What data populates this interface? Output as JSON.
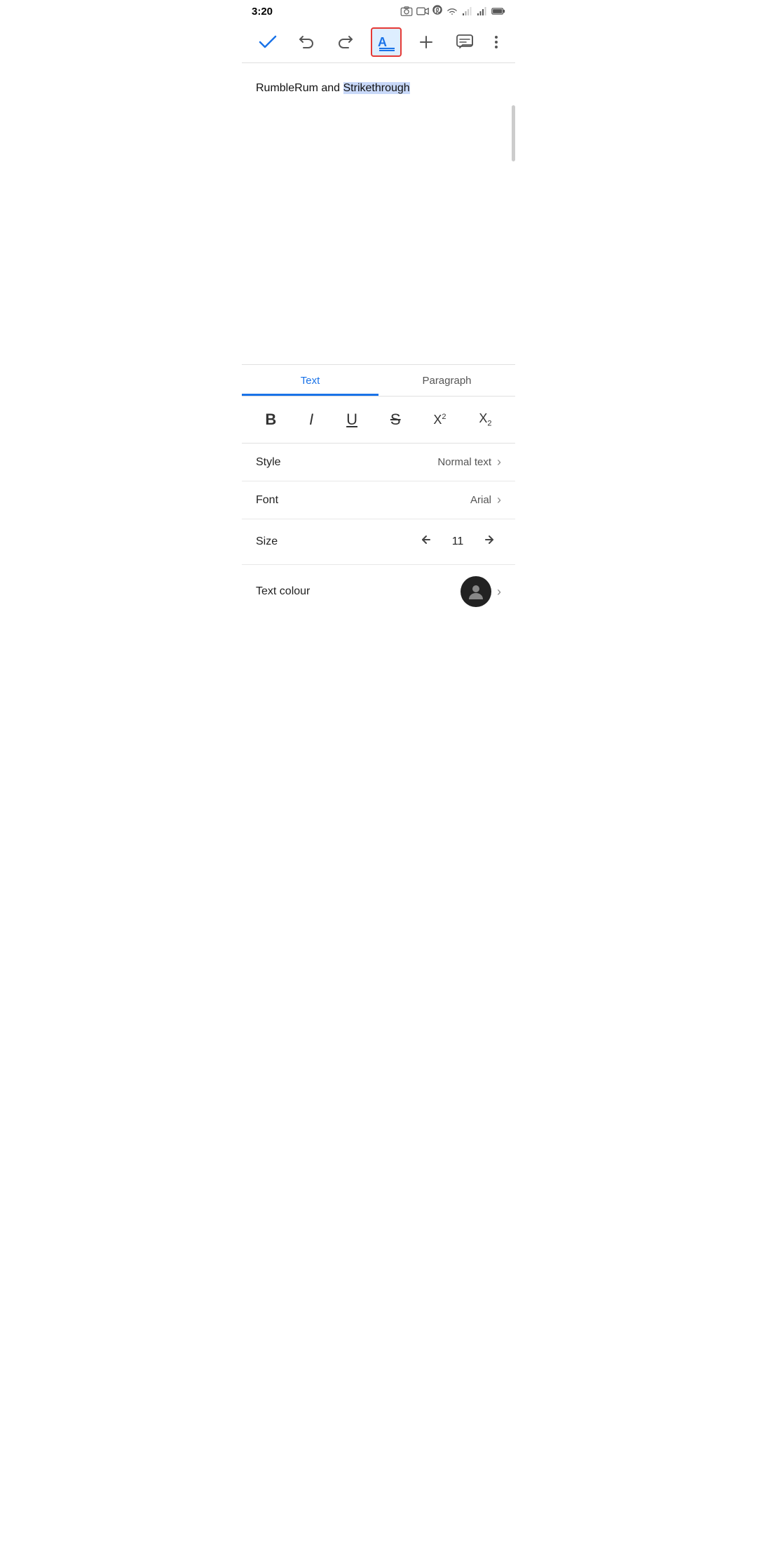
{
  "status_bar": {
    "time": "3:20",
    "icons": [
      "photo",
      "video",
      "pinterest",
      "wifi",
      "signal1",
      "signal2",
      "battery"
    ]
  },
  "toolbar": {
    "check_label": "✓",
    "undo_label": "↩",
    "redo_label": "↪",
    "format_text_label": "A≡",
    "add_label": "+",
    "comment_label": "💬",
    "more_label": "⋮"
  },
  "document": {
    "content_plain": "RumbleRum and ",
    "content_highlighted": "Strikethrough"
  },
  "format_panel": {
    "tabs": [
      {
        "id": "text",
        "label": "Text",
        "active": true
      },
      {
        "id": "paragraph",
        "label": "Paragraph",
        "active": false
      }
    ],
    "text_format_buttons": [
      {
        "id": "bold",
        "label": "B",
        "type": "bold"
      },
      {
        "id": "italic",
        "label": "I",
        "type": "italic"
      },
      {
        "id": "underline",
        "label": "U",
        "type": "underline"
      },
      {
        "id": "strikethrough",
        "label": "S",
        "type": "strikethrough"
      },
      {
        "id": "superscript",
        "label": "X²",
        "type": "superscript"
      },
      {
        "id": "subscript",
        "label": "X₂",
        "type": "subscript"
      }
    ],
    "options": [
      {
        "id": "style",
        "label": "Style",
        "value": "Normal text"
      },
      {
        "id": "font",
        "label": "Font",
        "value": "Arial"
      },
      {
        "id": "size",
        "label": "Size",
        "value": "11",
        "type": "stepper"
      },
      {
        "id": "text-colour",
        "label": "Text colour",
        "value": "",
        "type": "colour"
      }
    ]
  },
  "colors": {
    "accent_blue": "#1a73e8",
    "highlight_bg": "#c8d8f8",
    "active_toolbar_bg": "#ddeeff",
    "active_toolbar_border": "#e53935"
  }
}
